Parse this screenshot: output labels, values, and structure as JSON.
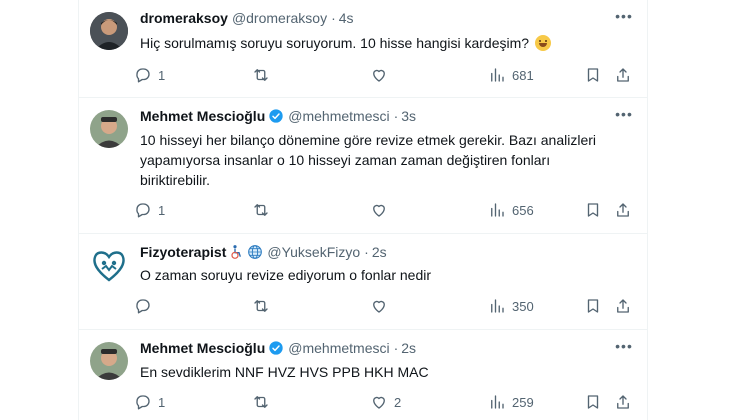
{
  "tweets": [
    {
      "name": "dromeraksoy",
      "handle": "@dromeraksoy",
      "dot": "·",
      "time": "4s",
      "verified": false,
      "text": "Hiç sorulmamış soruyu soruyorum. 10 hisse hangisi kardeşim?",
      "emoji": "grinning-face-emoji",
      "replies": "1",
      "retweets": "",
      "likes": "",
      "views": "681"
    },
    {
      "name": "Mehmet Mescioğlu",
      "handle": "@mehmetmesci",
      "dot": "·",
      "time": "3s",
      "verified": true,
      "text_lines": [
        "10 hisseyi her bilanço dönemine göre revize etmek gerekir. Bazı analizleri",
        "yapamıyorsa insanlar o 10 hisseyi zaman zaman değiştiren fonları",
        "biriktirebilir."
      ],
      "replies": "1",
      "retweets": "",
      "likes": "",
      "views": "656"
    },
    {
      "name": "Fizyoterapist",
      "handle": "@YuksekFizyo",
      "dot": "·",
      "time": "2s",
      "verified": false,
      "name_emojis": [
        "wheelchair-person-emoji",
        "globe-emoji"
      ],
      "text": "O zaman soruyu revize ediyorum o fonlar nedir",
      "replies": "",
      "retweets": "",
      "likes": "",
      "views": "350"
    },
    {
      "name": "Mehmet Mescioğlu",
      "handle": "@mehmetmesci",
      "dot": "·",
      "time": "2s",
      "verified": true,
      "text": "En sevdiklerim NNF HVZ HVS PPB HKH MAC",
      "replies": "1",
      "retweets": "",
      "likes": "2",
      "views": "259"
    }
  ],
  "colors": {
    "text": "#0f1419",
    "muted": "#536471",
    "verified": "#1d9bf0",
    "border": "#eff3f4"
  }
}
